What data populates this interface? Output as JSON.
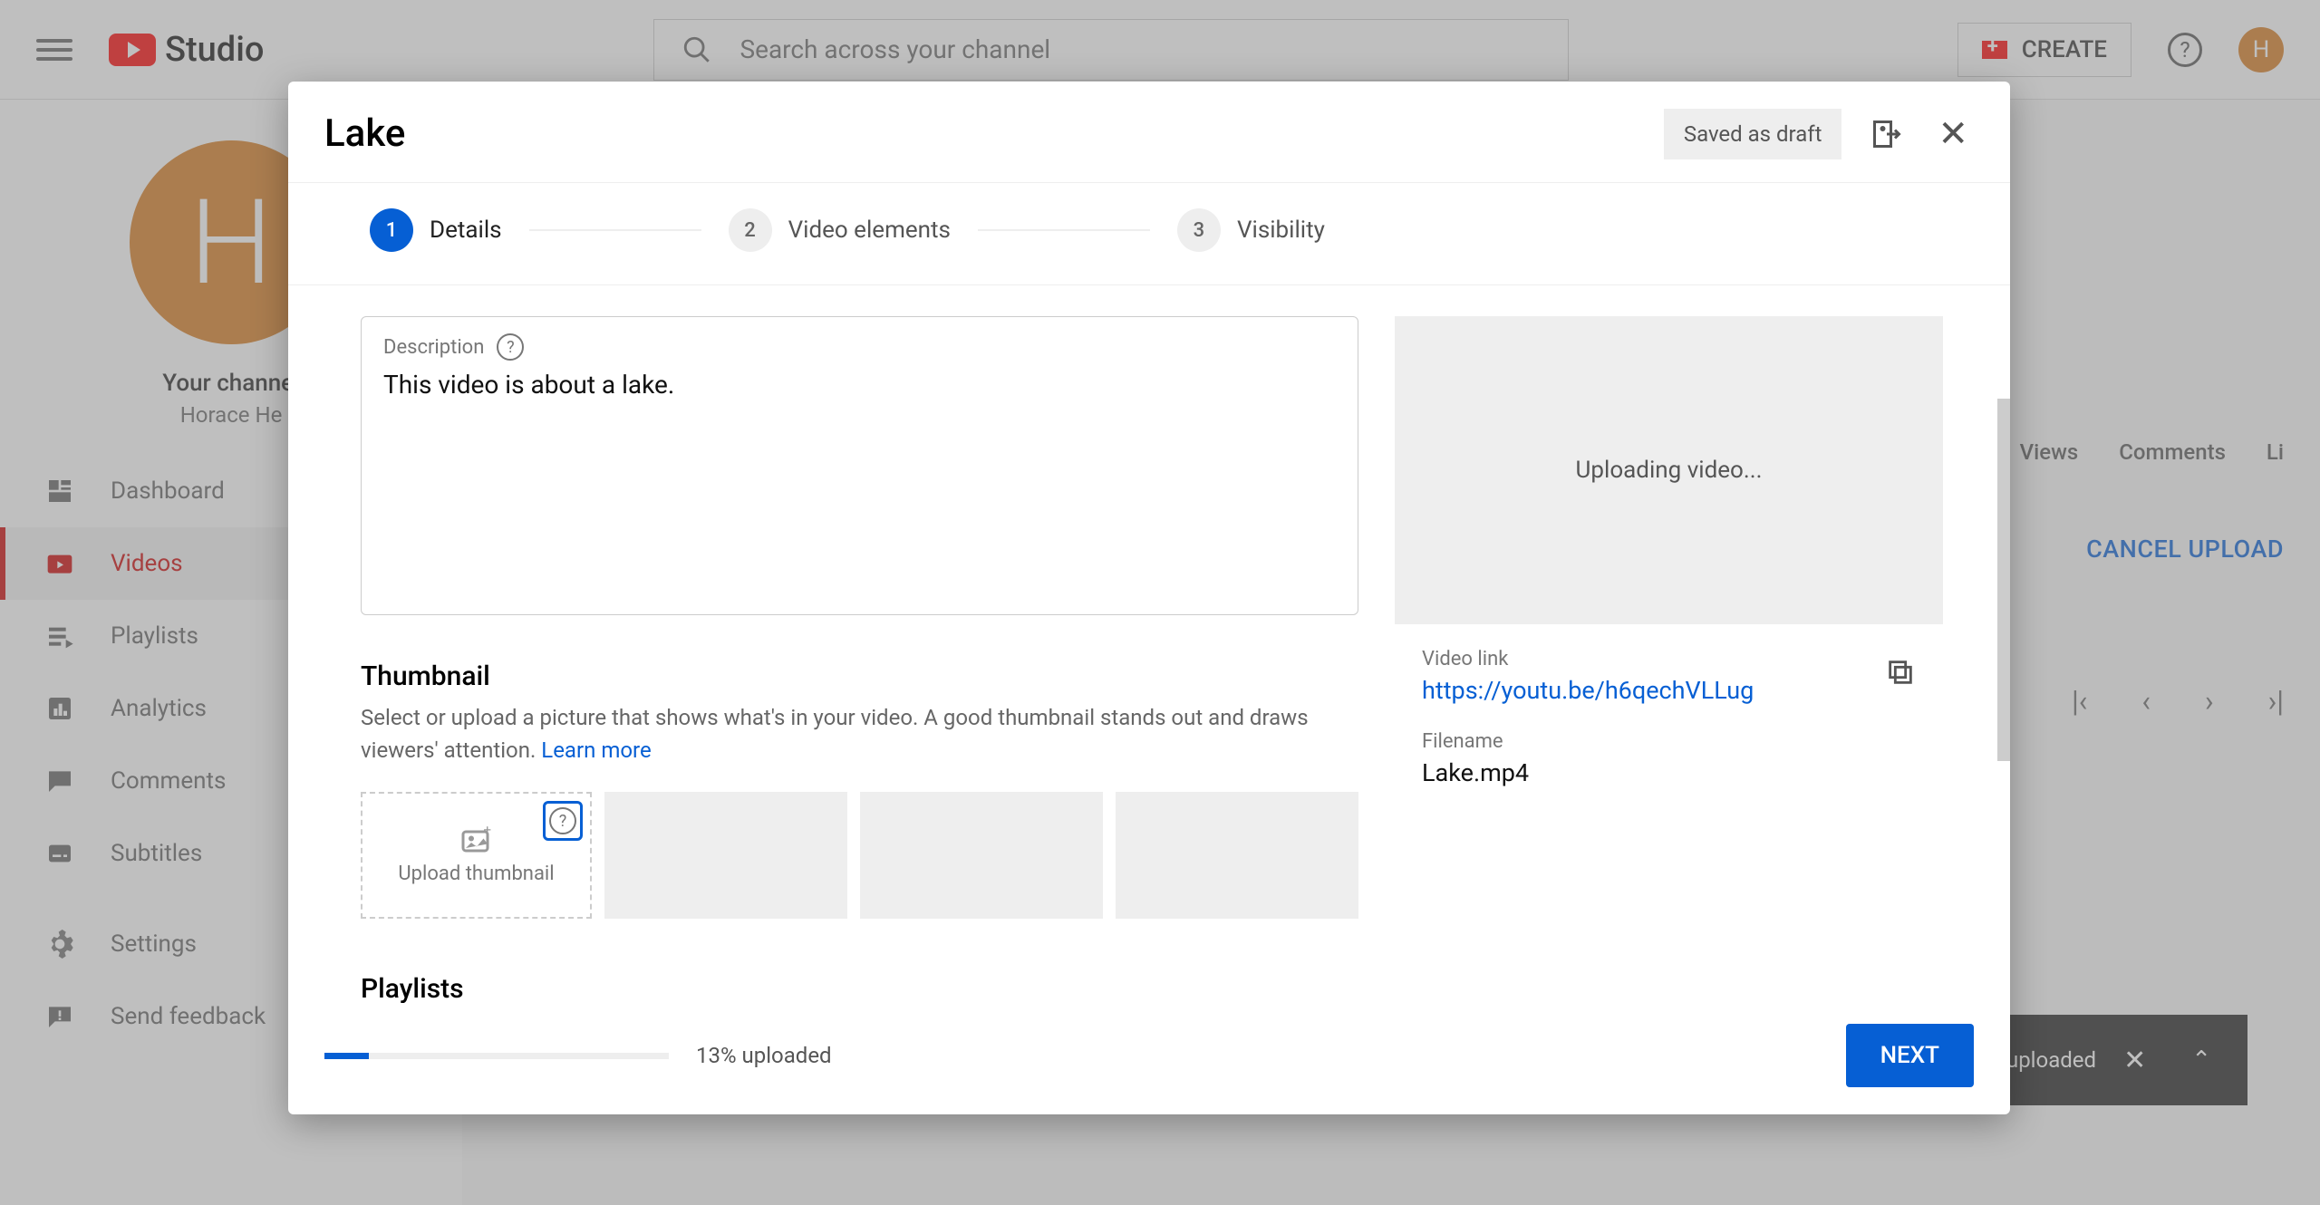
{
  "brand": "Studio",
  "search_placeholder": "Search across your channel",
  "create_label": "CREATE",
  "avatar_letter": "H",
  "channel": {
    "your_channel_label": "Your channel",
    "name": "Horace He"
  },
  "sidebar": {
    "items": [
      {
        "label": "Dashboard"
      },
      {
        "label": "Videos"
      },
      {
        "label": "Playlists"
      },
      {
        "label": "Analytics"
      },
      {
        "label": "Comments"
      },
      {
        "label": "Subtitles"
      },
      {
        "label": "Settings"
      },
      {
        "label": "Send feedback"
      }
    ]
  },
  "bg": {
    "cols": [
      "Views",
      "Comments",
      "Li"
    ],
    "cancel_upload": "CANCEL UPLOAD",
    "toast": "uploaded"
  },
  "modal": {
    "title": "Lake",
    "saved_badge": "Saved as draft",
    "steps": [
      {
        "num": "1",
        "label": "Details"
      },
      {
        "num": "2",
        "label": "Video elements"
      },
      {
        "num": "3",
        "label": "Visibility"
      }
    ],
    "description": {
      "label": "Description",
      "value": "This video is about a lake."
    },
    "thumbnail": {
      "title": "Thumbnail",
      "subtitle": "Select or upload a picture that shows what's in your video. A good thumbnail stands out and draws viewers' attention. ",
      "learn_more": "Learn more",
      "upload_label": "Upload thumbnail"
    },
    "playlists_title": "Playlists",
    "preview": {
      "status": "Uploading video...",
      "link_label": "Video link",
      "link": "https://youtu.be/h6qechVLLug",
      "filename_label": "Filename",
      "filename": "Lake.mp4"
    },
    "progress_text": "13% uploaded",
    "next_label": "NEXT"
  }
}
